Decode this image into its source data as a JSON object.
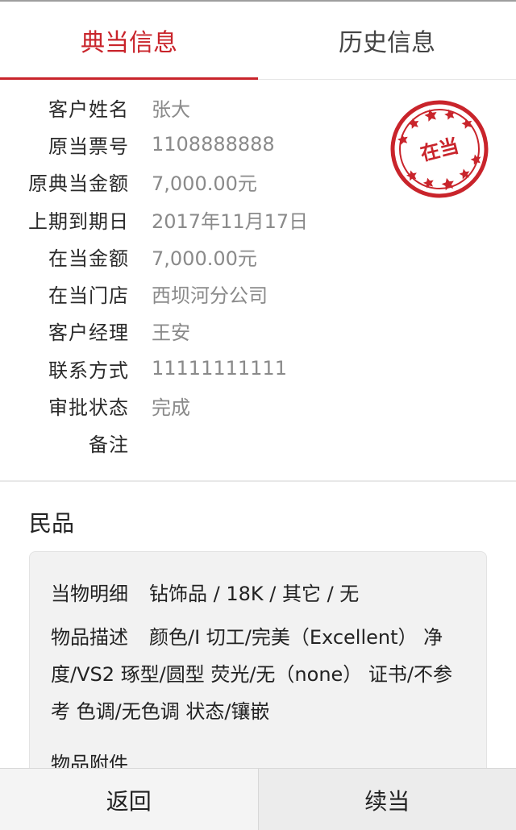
{
  "tabs": [
    {
      "label": "典当信息",
      "active": true
    },
    {
      "label": "历史信息",
      "active": false
    }
  ],
  "info": [
    {
      "label": "客户姓名",
      "value": "张大"
    },
    {
      "label": "原当票号",
      "value": "1108888888"
    },
    {
      "label": "原典当金额",
      "value": "7,000.00元"
    },
    {
      "label": "上期到期日",
      "value": "2017年11月17日"
    },
    {
      "label": "在当金额",
      "value": "7,000.00元"
    },
    {
      "label": "在当门店",
      "value": "西坝河分公司"
    },
    {
      "label": "客户经理",
      "value": "王安"
    },
    {
      "label": "联系方式",
      "value": "11111111111"
    },
    {
      "label": "审批状态",
      "value": "完成"
    },
    {
      "label": "备注",
      "value": ""
    }
  ],
  "stamp": {
    "text": "在当",
    "color": "#c9242b",
    "icon": "pawn-stamp-icon"
  },
  "section": {
    "title": "民品",
    "details_label": "当物明细",
    "details_value": "钻饰品 / 18K / 其它 / 无",
    "desc_label": "物品描述",
    "desc_value": "颜色/I 切工/完美（Excellent） 净度/VS2 琢型/圆型 荧光/无（none） 证书/不参考 色调/无色调 状态/镶嵌",
    "attach_label": "物品附件"
  },
  "buttons": {
    "back": "返回",
    "renew": "续当"
  },
  "colors": {
    "accent": "#c9242b"
  }
}
